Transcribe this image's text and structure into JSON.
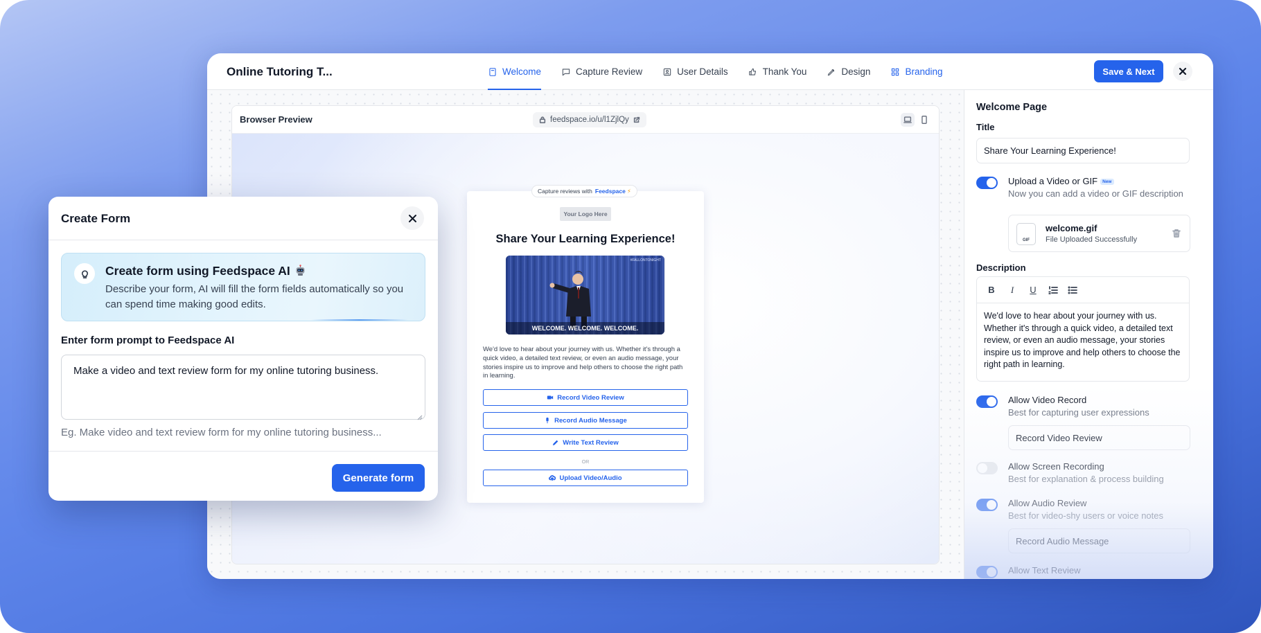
{
  "app": {
    "title": "Online Tutoring T..."
  },
  "tabs": [
    {
      "label": "Welcome",
      "icon": "file-icon"
    },
    {
      "label": "Capture Review",
      "icon": "message-square-icon"
    },
    {
      "label": "User Details",
      "icon": "id-card-icon"
    },
    {
      "label": "Thank You",
      "icon": "thumbs-up-icon"
    },
    {
      "label": "Design",
      "icon": "pen-icon"
    },
    {
      "label": "Branding",
      "icon": "grid-icon"
    }
  ],
  "toolbar": {
    "save_label": "Save & Next"
  },
  "preview": {
    "title": "Browser Preview",
    "url": "feedspace.io/u/l1ZjlQy",
    "capture_prefix": "Capture reviews with",
    "capture_brand": "Feedspace",
    "logo_placeholder": "Your Logo Here",
    "card_title": "Share Your Learning Experience!",
    "gif_caption": "WELCOME. WELCOME. WELCOME.",
    "gif_watermark": "#FALLONTONIGHT",
    "description": "We'd love to hear about your journey with us. Whether it's through a quick video, a detailed text review, or even an audio message, your stories inspire us to improve and help others to choose the right path in learning.",
    "buttons": {
      "record_video": "Record Video Review",
      "record_audio": "Record Audio Message",
      "write_text": "Write Text Review",
      "or": "OR",
      "upload": "Upload Video/Audio"
    }
  },
  "panel": {
    "heading": "Welcome Page",
    "title_label": "Title",
    "title_value": "Share Your Learning Experience!",
    "upload": {
      "title": "Upload a Video or GIF",
      "badge": "New",
      "subtitle": "Now you can add a video or GIF description",
      "enabled": true
    },
    "file": {
      "name": "welcome.gif",
      "status": "File Uploaded Successfully",
      "type": "GIF"
    },
    "description_label": "Description",
    "rt": {
      "bold": "B",
      "italic": "I",
      "underline": "U"
    },
    "description_text": "We'd love to hear about your journey with us. Whether it's through a quick video, a detailed text review, or even an audio message, your stories inspire us to improve and help others to choose the right path in learning.",
    "video_record": {
      "title": "Allow Video Record",
      "subtitle": "Best for capturing user expressions",
      "enabled": true,
      "button_label": "Record Video Review"
    },
    "screen_recording": {
      "title": "Allow Screen Recording",
      "subtitle": "Best for explanation & process building",
      "enabled": false
    },
    "audio_review": {
      "title": "Allow Audio Review",
      "subtitle": "Best for video-shy users or voice notes",
      "enabled": true,
      "button_label": "Record Audio Message"
    },
    "text_review": {
      "title": "Allow Text Review",
      "enabled": true
    }
  },
  "modal": {
    "title": "Create Form",
    "ai_title": "Create form using Feedspace AI",
    "ai_desc": "Describe your form, AI will fill the form fields automatically so you can spend time making good edits.",
    "prompt_label": "Enter form prompt to Feedspace AI",
    "prompt_value": "Make a video and text review form for my online tutoring business.",
    "hint": "Eg. Make video and text review form for my online tutoring business...",
    "generate_label": "Generate form"
  },
  "colors": {
    "accent": "#2563eb",
    "background_gradient_top": "#b4c6f5",
    "background_gradient_bottom": "#2f55bd"
  }
}
